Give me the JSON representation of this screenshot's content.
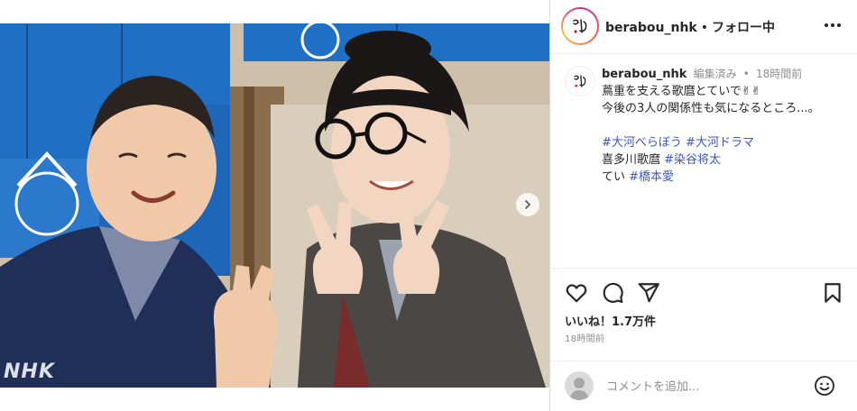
{
  "post": {
    "username": "berabou_nhk",
    "separator": "•",
    "follow_status": "フォロー中",
    "watermark": "NHK"
  },
  "caption": {
    "username": "berabou_nhk",
    "edited": "編集済み",
    "bullet": "•",
    "time": "18時間前",
    "line1": "蔦重を支える歌麿とていで✌✌",
    "line2": "今後の3人の関係性も気になるところ...。",
    "tags1": [
      "#大河べらぼう",
      "#大河ドラマ"
    ],
    "line4_text": "喜多川歌麿",
    "line4_tag": "#染谷将太",
    "line5_text": "てい",
    "line5_tag": "#橋本愛"
  },
  "actions": {
    "likes": "いいね！1.7万件",
    "time": "18時間前"
  },
  "comment": {
    "placeholder": "コメントを追加..."
  },
  "icons": {
    "like": "heart-icon",
    "comment": "comment-icon",
    "share": "share-icon",
    "save": "bookmark-icon",
    "emoji": "smile-icon",
    "more": "more-icon",
    "next": "chevron-right-icon"
  },
  "colors": {
    "hashtag": "#3b57c4",
    "curtain_blue": "#1f6fc4",
    "text": "#262626",
    "muted": "#8e8e8e"
  }
}
